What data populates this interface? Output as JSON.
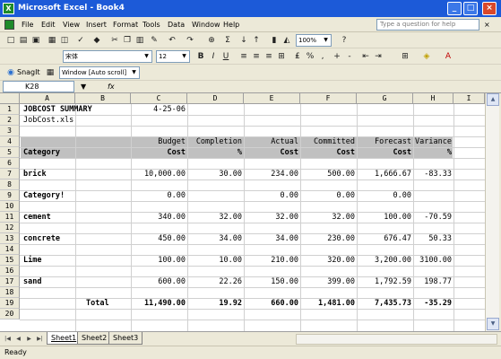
{
  "window": {
    "title": "Microsoft Excel - Book4"
  },
  "menus": [
    "File",
    "Edit",
    "View",
    "Insert",
    "Format",
    "Tools",
    "Data",
    "Window",
    "Help"
  ],
  "help_placeholder": "Type a question for help",
  "toolbar": {
    "zoom": "100%",
    "font": "宋体",
    "font_size": "12"
  },
  "snagit": {
    "label": "SnagIt",
    "capture_mode": "Window [Auto scroll]"
  },
  "formula_bar": {
    "name_box": "K28",
    "fx": "fx",
    "content": ""
  },
  "columns": [
    "A",
    "B",
    "C",
    "D",
    "E",
    "F",
    "G",
    "H",
    "I"
  ],
  "rows": [
    "1",
    "2",
    "3",
    "4",
    "5",
    "6",
    "7",
    "8",
    "9",
    "10",
    "11",
    "12",
    "13",
    "14",
    "15",
    "16",
    "17",
    "18",
    "19",
    "20"
  ],
  "cells": {
    "A1": "JOBCOST SUMMARY",
    "C1": "4-25-06",
    "A2": "JobCost.xls",
    "C4": "Budget",
    "D4": "Completion",
    "E4": "Actual",
    "F4": "Committed",
    "G4": "Forecast",
    "H4": "Variance",
    "A5": "Category",
    "C5": "Cost",
    "D5": "%",
    "E5": "Cost",
    "F5": "Cost",
    "G5": "Cost",
    "H5": "%",
    "A7": "brick",
    "C7": "10,000.00",
    "D7": "30.00",
    "E7": "234.00",
    "F7": "500.00",
    "G7": "1,666.67",
    "H7": "-83.33",
    "A9": "Category!",
    "C9": "0.00",
    "E9": "0.00",
    "F9": "0.00",
    "G9": "0.00",
    "A11": "cement",
    "C11": "340.00",
    "D11": "32.00",
    "E11": "32.00",
    "F11": "32.00",
    "G11": "100.00",
    "H11": "-70.59",
    "A13": "concrete",
    "C13": "450.00",
    "D13": "34.00",
    "E13": "34.00",
    "F13": "230.00",
    "G13": "676.47",
    "H13": "50.33",
    "A15": "Lime",
    "C15": "100.00",
    "D15": "10.00",
    "E15": "210.00",
    "F15": "320.00",
    "G15": "3,200.00",
    "H15": "3100.00",
    "A17": "sand",
    "C17": "600.00",
    "D17": "22.26",
    "E17": "150.00",
    "F17": "399.00",
    "G17": "1,792.59",
    "H17": "198.77",
    "B19": "Total",
    "C19": "11,490.00",
    "D19": "19.92",
    "E19": "660.00",
    "F19": "1,481.00",
    "G19": "7,435.73",
    "H19": "-35.29"
  },
  "sheets": [
    "Sheet1",
    "Sheet2",
    "Sheet3"
  ],
  "status": "Ready"
}
